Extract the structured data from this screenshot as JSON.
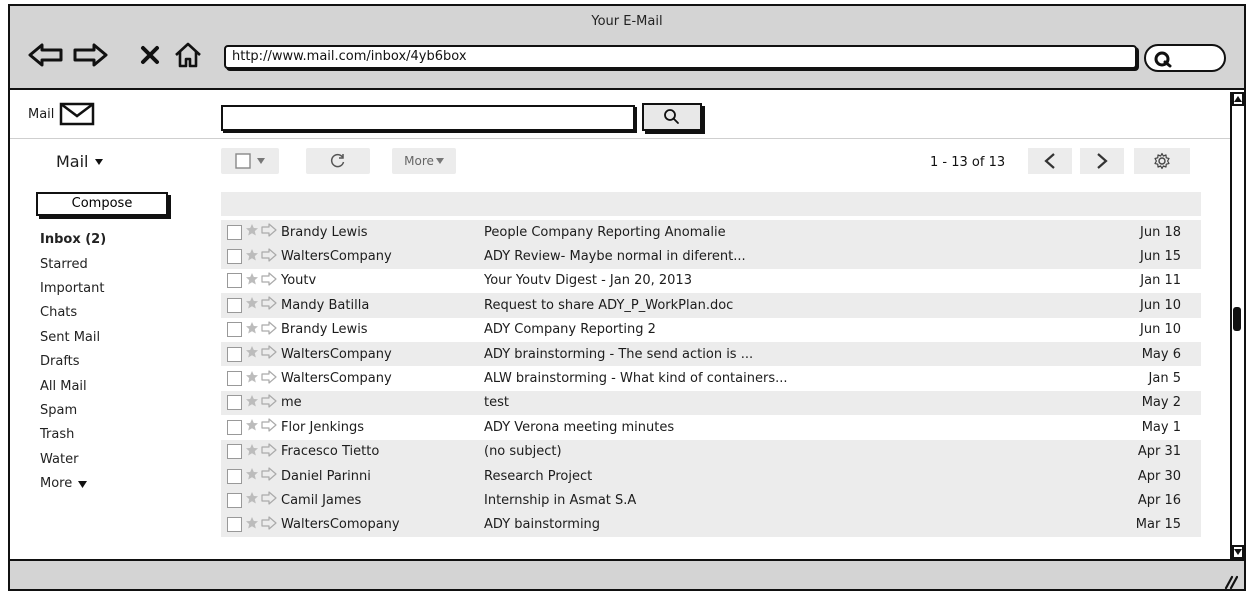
{
  "window": {
    "title": "Your E-Mail"
  },
  "browser": {
    "url": "http://www.mail.com/inbox/4yb6box",
    "icons": [
      "back-arrow-icon",
      "forward-arrow-icon",
      "close-icon",
      "home-icon",
      "search-icon"
    ]
  },
  "header": {
    "logo_label": "Mail",
    "logo_icon": "envelope-icon",
    "search_value": "",
    "search_icon": "search-icon"
  },
  "toolbar": {
    "mail_menu_label": "Mail",
    "more_label": "More",
    "pager_text": "1 - 13 of 13",
    "icons": [
      "checkbox-icon",
      "refresh-icon",
      "chevron-left-icon",
      "chevron-right-icon",
      "gear-icon"
    ]
  },
  "sidebar": {
    "compose_label": "Compose",
    "items": [
      {
        "label": "Inbox (2)",
        "bold": true
      },
      {
        "label": "Starred"
      },
      {
        "label": "Important"
      },
      {
        "label": "Chats"
      },
      {
        "label": "Sent Mail"
      },
      {
        "label": "Drafts"
      },
      {
        "label": "All Mail"
      },
      {
        "label": "Spam"
      },
      {
        "label": "Trash"
      },
      {
        "label": "Water"
      },
      {
        "label": "More"
      }
    ]
  },
  "messages": [
    {
      "sender": "Brandy Lewis",
      "subject": "People Company Reporting Anomalie",
      "date": "Jun 18",
      "unread": true
    },
    {
      "sender": "WaltersCompany",
      "subject": "ADY Review- Maybe normal in diferent...",
      "date": "Jun 15",
      "unread": true
    },
    {
      "sender": "Youtv",
      "subject": "Your Youtv Digest - Jan 20, 2013",
      "date": "Jan 11",
      "unread": false
    },
    {
      "sender": "Mandy Batilla",
      "subject": "Request to share ADY_P_WorkPlan.doc",
      "date": "Jun 10",
      "unread": true
    },
    {
      "sender": "Brandy Lewis",
      "subject": "ADY Company Reporting 2",
      "date": "Jun 10",
      "unread": false
    },
    {
      "sender": "WaltersCompany",
      "subject": "ADY brainstorming - The send action is ...",
      "date": "May 6",
      "unread": true
    },
    {
      "sender": "WaltersCompany",
      "subject": "ALW brainstorming - What kind of containers...",
      "date": "Jan 5",
      "unread": false
    },
    {
      "sender": "me",
      "subject": "test",
      "date": "May 2",
      "unread": true
    },
    {
      "sender": "Flor Jenkings",
      "subject": "ADY Verona meeting minutes",
      "date": "May 1",
      "unread": false
    },
    {
      "sender": "Fracesco Tietto",
      "subject": "(no subject)",
      "date": "Apr 31",
      "unread": true
    },
    {
      "sender": "Daniel Parinni",
      "subject": "Research Project",
      "date": "Apr 30",
      "unread": true
    },
    {
      "sender": "Camil James",
      "subject": "Internship in Asmat S.A",
      "date": "Apr 16",
      "unread": true
    },
    {
      "sender": "WaltersComopany",
      "subject": "ADY bainstorming",
      "date": "Mar 15",
      "unread": true
    }
  ],
  "colors": {
    "chrome": "#d4d4d4",
    "row_shade": "#ececec",
    "outline": "#111111",
    "star": "#bcbcbc"
  }
}
